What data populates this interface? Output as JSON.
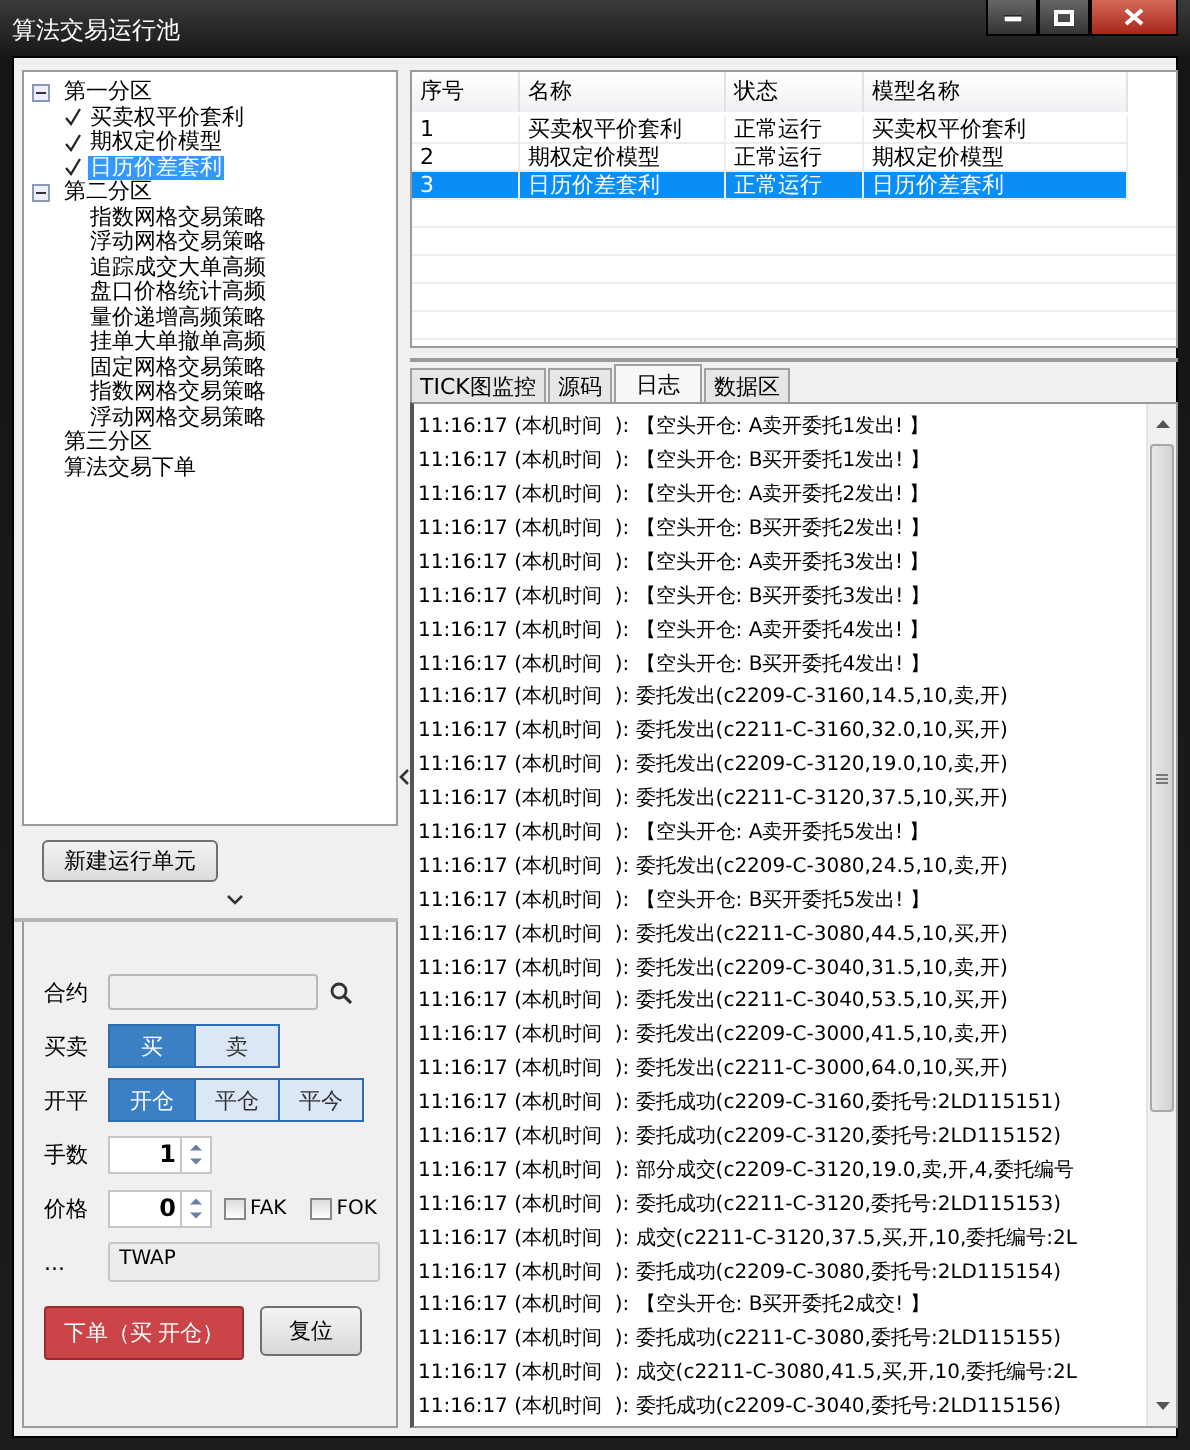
{
  "window": {
    "title": "算法交易运行池"
  },
  "tree": [
    {
      "label": "第一分区",
      "selected": false,
      "expanded": true,
      "children": [
        {
          "label": "买卖权平价套利",
          "selected": false,
          "checked": true
        },
        {
          "label": "期权定价模型",
          "selected": false,
          "checked": true
        },
        {
          "label": "日历价差套利",
          "selected": true,
          "checked": true
        }
      ]
    },
    {
      "label": "第二分区",
      "selected": false,
      "expanded": true,
      "children": [
        {
          "label": "指数网格交易策略",
          "selected": false,
          "checked": false
        },
        {
          "label": "浮动网格交易策略",
          "selected": false,
          "checked": false
        },
        {
          "label": "追踪成交大单高频",
          "selected": false,
          "checked": false
        },
        {
          "label": "盘口价格统计高频",
          "selected": false,
          "checked": false
        },
        {
          "label": "量价递增高频策略",
          "selected": false,
          "checked": false
        },
        {
          "label": "挂单大单撤单高频",
          "selected": false,
          "checked": false
        },
        {
          "label": "固定网格交易策略",
          "selected": false,
          "checked": false
        },
        {
          "label": "指数网格交易策略",
          "selected": false,
          "checked": false
        },
        {
          "label": "浮动网格交易策略",
          "selected": false,
          "checked": false
        }
      ]
    },
    {
      "label": "第三分区",
      "selected": false
    },
    {
      "label": "算法交易下单",
      "selected": false
    }
  ],
  "new_unit_button": "新建运行单元",
  "order": {
    "contract": {
      "label": "合约"
    },
    "side": {
      "label": "买卖",
      "options": [
        {
          "label": "买",
          "selected": true
        },
        {
          "label": "卖",
          "selected": false
        }
      ]
    },
    "offset": {
      "label": "开平",
      "options": [
        {
          "label": "开仓",
          "selected": true
        },
        {
          "label": "平仓",
          "selected": false
        },
        {
          "label": "平今",
          "selected": false
        }
      ]
    },
    "quantity": {
      "label": "手数",
      "value": "1"
    },
    "price": {
      "label": "价格",
      "value": "0"
    },
    "flags": [
      {
        "label": "FAK",
        "checked": false
      },
      {
        "label": "FOK",
        "checked": false
      }
    ],
    "algo": {
      "label": "...",
      "value": "TWAP"
    },
    "submit_button": "下单（买 开仓）",
    "reset_button": "复位"
  },
  "table": {
    "columns": [
      "序号",
      "名称",
      "状态",
      "模型名称"
    ],
    "rows": [
      {
        "cells": [
          "1",
          "买卖权平价套利",
          "正常运行",
          "买卖权平价套利"
        ],
        "selected": false
      },
      {
        "cells": [
          "2",
          "期权定价模型",
          "正常运行",
          "期权定价模型"
        ],
        "selected": false
      },
      {
        "cells": [
          "3",
          "日历价差套利",
          "正常运行",
          "日历价差套利"
        ],
        "selected": true
      }
    ]
  },
  "tabs": [
    {
      "label": "TICK图监控",
      "selected": false
    },
    {
      "label": "源码",
      "selected": false
    },
    {
      "label": "日志",
      "selected": true
    },
    {
      "label": "数据区",
      "selected": false
    }
  ],
  "log": [
    "11:16:17 (本机时间  ): 【空头开仓: A卖开委托1发出! 】",
    "11:16:17 (本机时间  ): 【空头开仓: B买开委托1发出! 】",
    "11:16:17 (本机时间  ): 【空头开仓: A卖开委托2发出! 】",
    "11:16:17 (本机时间  ): 【空头开仓: B买开委托2发出! 】",
    "11:16:17 (本机时间  ): 【空头开仓: A卖开委托3发出! 】",
    "11:16:17 (本机时间  ): 【空头开仓: B买开委托3发出! 】",
    "11:16:17 (本机时间  ): 【空头开仓: A卖开委托4发出! 】",
    "11:16:17 (本机时间  ): 【空头开仓: B买开委托4发出! 】",
    "11:16:17 (本机时间  ): 委托发出(c2209-C-3160,14.5,10,卖,开)",
    "11:16:17 (本机时间  ): 委托发出(c2211-C-3160,32.0,10,买,开)",
    "11:16:17 (本机时间  ): 委托发出(c2209-C-3120,19.0,10,卖,开)",
    "11:16:17 (本机时间  ): 委托发出(c2211-C-3120,37.5,10,买,开)",
    "11:16:17 (本机时间  ): 【空头开仓: A卖开委托5发出! 】",
    "11:16:17 (本机时间  ): 委托发出(c2209-C-3080,24.5,10,卖,开)",
    "11:16:17 (本机时间  ): 【空头开仓: B买开委托5发出! 】",
    "11:16:17 (本机时间  ): 委托发出(c2211-C-3080,44.5,10,买,开)",
    "11:16:17 (本机时间  ): 委托发出(c2209-C-3040,31.5,10,卖,开)",
    "11:16:17 (本机时间  ): 委托发出(c2211-C-3040,53.5,10,买,开)",
    "11:16:17 (本机时间  ): 委托发出(c2209-C-3000,41.5,10,卖,开)",
    "11:16:17 (本机时间  ): 委托发出(c2211-C-3000,64.0,10,买,开)",
    "11:16:17 (本机时间  ): 委托成功(c2209-C-3160,委托号:2LD115151)",
    "11:16:17 (本机时间  ): 委托成功(c2209-C-3120,委托号:2LD115152)",
    "11:16:17 (本机时间  ): 部分成交(c2209-C-3120,19.0,卖,开,4,委托编号",
    "11:16:17 (本机时间  ): 委托成功(c2211-C-3120,委托号:2LD115153)",
    "11:16:17 (本机时间  ): 成交(c2211-C-3120,37.5,买,开,10,委托编号:2L",
    "11:16:17 (本机时间  ): 委托成功(c2209-C-3080,委托号:2LD115154)",
    "11:16:17 (本机时间  ): 【空头开仓: B买开委托2成交! 】",
    "11:16:17 (本机时间  ): 委托成功(c2211-C-3080,委托号:2LD115155)",
    "11:16:17 (本机时间  ): 成交(c2211-C-3080,41.5,买,开,10,委托编号:2L",
    "11:16:17 (本机时间  ): 委托成功(c2209-C-3040,委托号:2LD115156)"
  ]
}
